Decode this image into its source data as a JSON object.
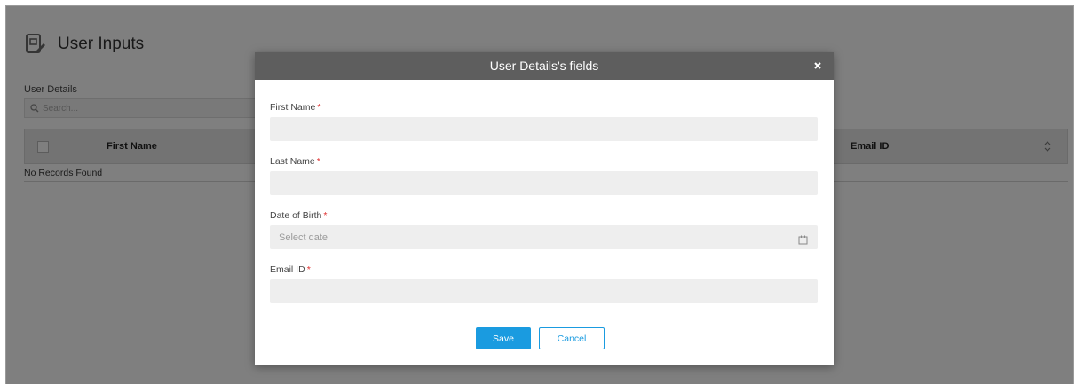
{
  "page": {
    "title": "User Inputs",
    "section_label": "User Details",
    "search_placeholder": "Search...",
    "table": {
      "columns": [
        "First Name",
        "Email ID"
      ],
      "empty_text": "No Records Found"
    },
    "icons": {
      "header": "document-edit-icon",
      "search": "search-icon",
      "sort": "sort-icon"
    }
  },
  "modal": {
    "title": "User Details's fields",
    "close_icon": "close-icon",
    "required_marker": "*",
    "fields": [
      {
        "label": "First Name",
        "value": "",
        "placeholder": ""
      },
      {
        "label": "Last Name",
        "value": "",
        "placeholder": ""
      },
      {
        "label": "Date of Birth",
        "value": "",
        "placeholder": "Select date",
        "icon": "calendar-icon"
      },
      {
        "label": "Email ID",
        "value": "",
        "placeholder": ""
      }
    ],
    "buttons": {
      "save": "Save",
      "cancel": "Cancel"
    }
  },
  "colors": {
    "primary": "#1a9be0",
    "modal_header": "#5e5e5e",
    "required": "#e03030",
    "input_bg": "#eeeeee"
  }
}
